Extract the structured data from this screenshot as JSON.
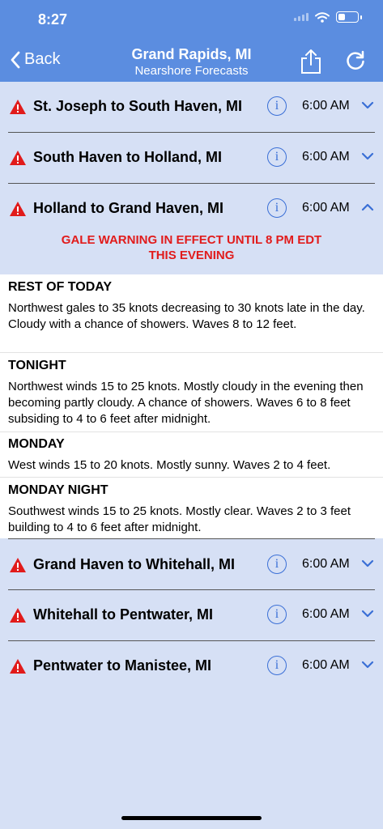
{
  "status": {
    "time": "8:27"
  },
  "nav": {
    "back": "Back",
    "title": "Grand Rapids, MI",
    "subtitle": "Nearshore Forecasts"
  },
  "zones": [
    {
      "name": "St. Joseph to South Haven, MI",
      "time": "6:00 AM"
    },
    {
      "name": "South Haven to Holland, MI",
      "time": "6:00 AM"
    },
    {
      "name": "Holland to Grand Haven, MI",
      "time": "6:00 AM"
    },
    {
      "name": "Grand Haven to Whitehall, MI",
      "time": "6:00 AM"
    },
    {
      "name": "Whitehall to Pentwater, MI",
      "time": "6:00 AM"
    },
    {
      "name": "Pentwater to Manistee, MI",
      "time": "6:00 AM"
    }
  ],
  "warning": {
    "line1": "GALE WARNING IN EFFECT UNTIL 8 PM EDT",
    "line2": "THIS EVENING"
  },
  "forecast": [
    {
      "title": "REST OF TODAY",
      "text": "Northwest gales to 35 knots decreasing to 30 knots late in the day. Cloudy with a chance of showers. Waves 8 to 12 feet."
    },
    {
      "title": "TONIGHT",
      "text": "Northwest winds 15 to 25 knots. Mostly cloudy in the evening then becoming partly cloudy. A chance of showers. Waves 6 to 8 feet subsiding to 4 to 6 feet after midnight."
    },
    {
      "title": "MONDAY",
      "text": "West winds 15 to 20 knots. Mostly sunny. Waves 2 to 4 feet."
    },
    {
      "title": "MONDAY NIGHT",
      "text": "Southwest winds 15 to 25 knots. Mostly clear. Waves 2 to 3 feet building to 4 to 6 feet after midnight."
    }
  ],
  "colors": {
    "header": "#5b8de0",
    "background": "#d6e0f5",
    "accent": "#3a6fd6",
    "warning": "#e11b1b"
  }
}
